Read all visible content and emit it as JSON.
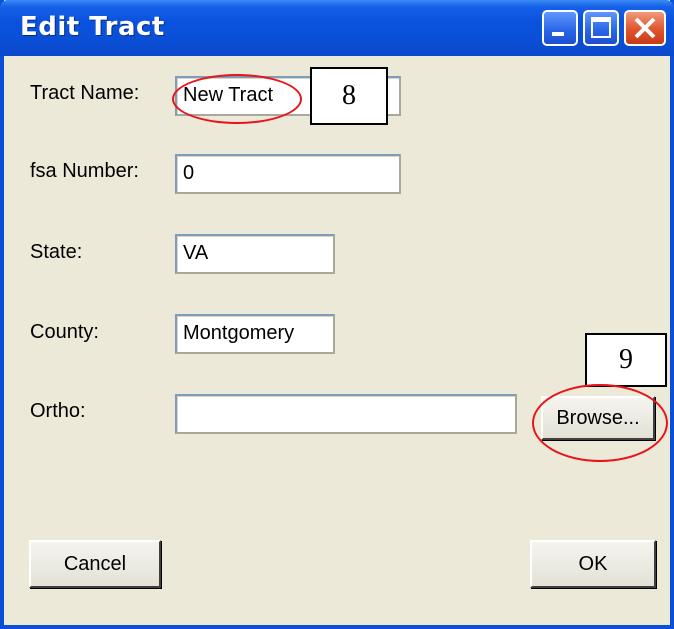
{
  "window": {
    "title": "Edit Tract",
    "minimize_icon": "minimize-icon",
    "maximize_icon": "maximize-icon",
    "close_icon": "close-icon"
  },
  "form": {
    "tract_name": {
      "label": "Tract Name:",
      "value": "New Tract"
    },
    "fsa_number": {
      "label": "fsa Number:",
      "value": "0"
    },
    "state": {
      "label": "State:",
      "value": "VA"
    },
    "county": {
      "label": "County:",
      "value": "Montgomery"
    },
    "ortho": {
      "label": "Ortho:",
      "value": ""
    }
  },
  "buttons": {
    "browse": "Browse...",
    "cancel": "Cancel",
    "ok": "OK"
  },
  "annotations": {
    "callout_8": "8",
    "callout_9": "9",
    "highlight_color": "#e8141a"
  }
}
